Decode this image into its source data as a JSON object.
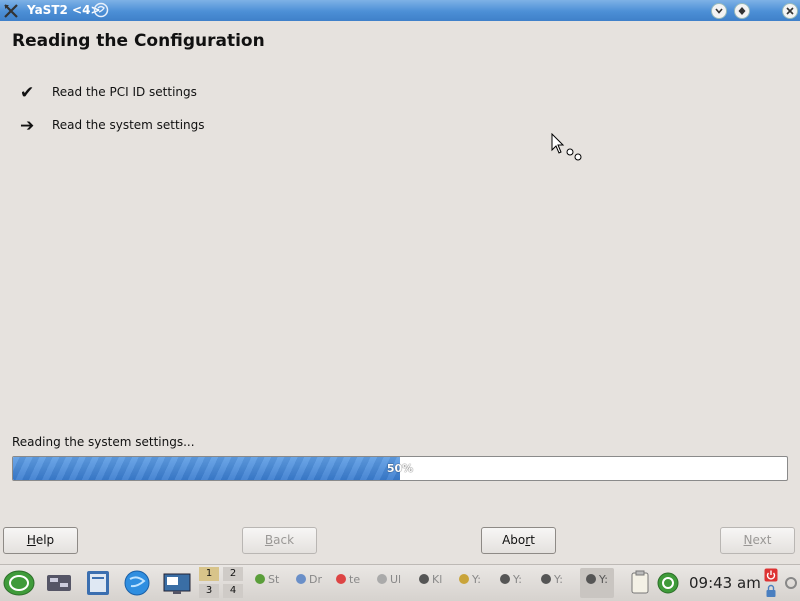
{
  "window": {
    "title": "YaST2 <4>"
  },
  "page": {
    "title": "Reading the Configuration",
    "steps": [
      {
        "mark": "✔",
        "label": "Read the PCI ID settings"
      },
      {
        "mark": "➔",
        "label": "Read the system settings"
      }
    ]
  },
  "progress": {
    "caption": "Reading the system settings...",
    "value_percent": 50,
    "text": "50%"
  },
  "buttons": {
    "help": {
      "pre": "",
      "ul": "H",
      "post": "elp"
    },
    "back": {
      "pre": "",
      "ul": "B",
      "post": "ack"
    },
    "abort": {
      "pre": "Abo",
      "ul": "r",
      "post": "t"
    },
    "next": {
      "pre": "",
      "ul": "N",
      "post": "ext"
    }
  },
  "taskbar": {
    "desktops": [
      "1",
      "2",
      "3",
      "4"
    ],
    "tasks": [
      {
        "label": "St",
        "icon_color": "#5a9e3a"
      },
      {
        "label": "Dr",
        "icon_color": "#6a8fc8"
      },
      {
        "label": "te",
        "icon_color": "#d44"
      },
      {
        "label": "Ul",
        "icon_color": "#aaa"
      },
      {
        "label": "Kl",
        "icon_color": "#555"
      },
      {
        "label": "Y:",
        "icon_color": "#c9a43a"
      },
      {
        "label": "Y:",
        "icon_color": "#555"
      },
      {
        "label": "Y:",
        "icon_color": "#555"
      },
      {
        "label": "Y:",
        "icon_color": "#555"
      }
    ],
    "clock": "09:43 am"
  },
  "colors": {
    "titlebar": "#4c8fd6",
    "progress_fill": "#3a7ccf",
    "background": "#e6e2de"
  }
}
